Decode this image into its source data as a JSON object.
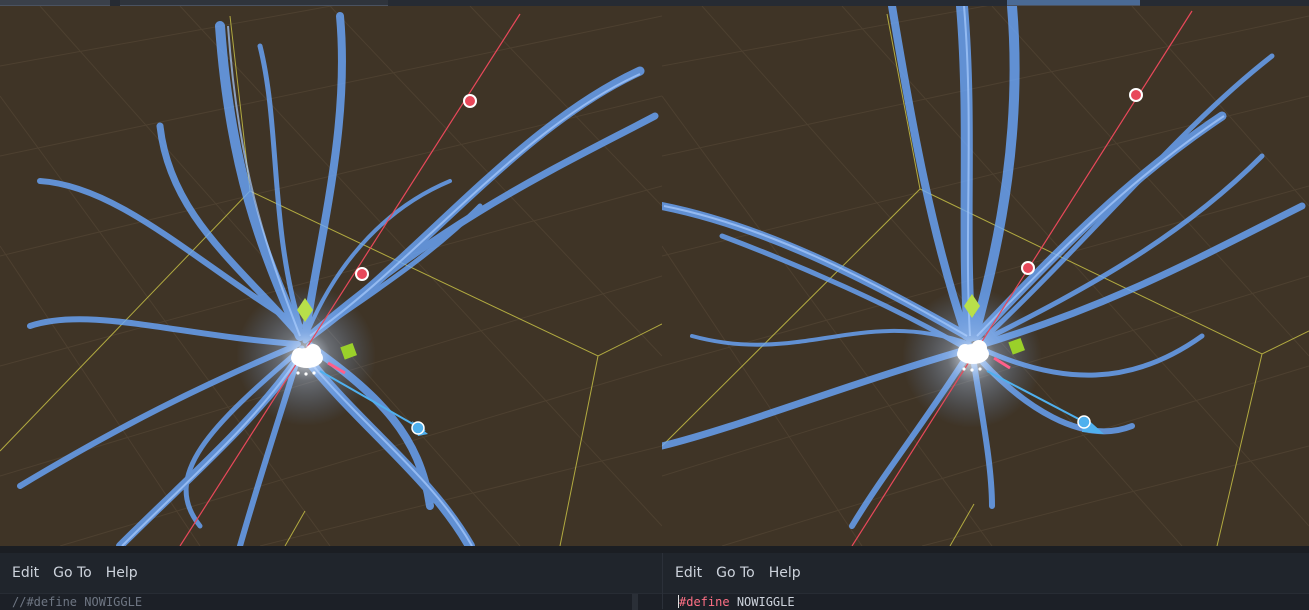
{
  "colors": {
    "viewport_bg": "#3f3426",
    "grid_line": "#4d4030",
    "axis_x": "#e8485a",
    "axis_y": "#d8d24a",
    "axis_z": "#4fb0ee",
    "particle": "#6aa8ff",
    "menu_text": "#cdd3dc",
    "code_keyword": "#ff7085",
    "code_comment": "#6e7683"
  },
  "viewports": [
    {
      "name": "left",
      "gizmo_icons": [
        "light-bulb-icon",
        "sphere-handle-icon",
        "box-handle-icon"
      ]
    },
    {
      "name": "right",
      "gizmo_icons": [
        "light-bulb-icon",
        "sphere-handle-icon",
        "box-handle-icon"
      ]
    }
  ],
  "editors": {
    "left": {
      "menu": [
        "Edit",
        "Go To",
        "Help"
      ],
      "code_comment_prefix": "//",
      "code_directive": "#define",
      "code_symbol": "NOWIGGLE"
    },
    "right": {
      "menu": [
        "Edit",
        "Go To",
        "Help"
      ],
      "code_directive": "#define",
      "code_symbol": "NOWIGGLE"
    }
  }
}
